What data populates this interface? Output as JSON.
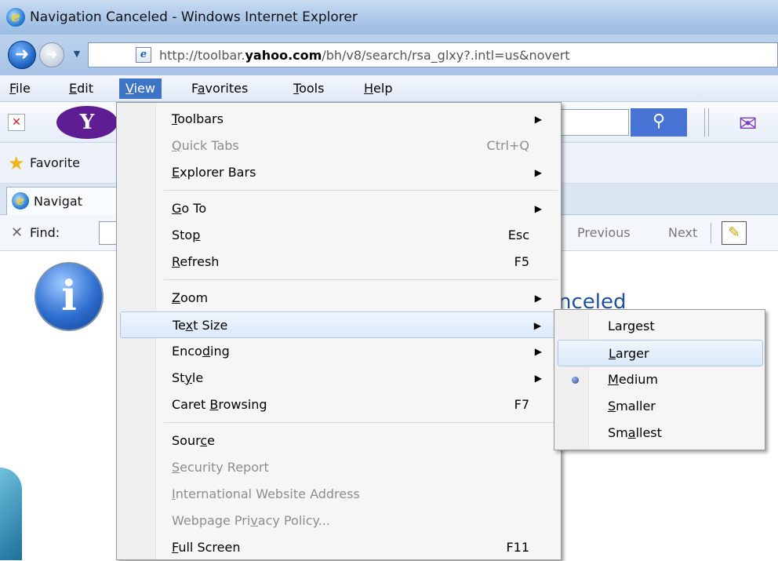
{
  "window": {
    "title": "Navigation Canceled - Windows Internet Explorer"
  },
  "address_bar": {
    "url_prefix": "http://toolbar.",
    "url_bold": "yahoo.com",
    "url_suffix": "/bh/v8/search/rsa_glxy?.intl=us&novert"
  },
  "menubar": {
    "items": [
      "File",
      "Edit",
      "View",
      "Favorites",
      "Tools",
      "Help"
    ],
    "active": "View"
  },
  "yahoo_toolbar": {
    "logo": "Y"
  },
  "favorites_bar": {
    "label": "Favorite"
  },
  "tabs": [
    {
      "label": "Navigat"
    }
  ],
  "find_bar": {
    "label": "Find:",
    "previous": "Previous",
    "next": "Next"
  },
  "page": {
    "heading": "nceled"
  },
  "view_menu": {
    "items": [
      {
        "label": "Toolbars",
        "shortcut": "",
        "submenu": true,
        "disabled": false
      },
      {
        "label": "Quick Tabs",
        "shortcut": "Ctrl+Q",
        "submenu": false,
        "disabled": true
      },
      {
        "label": "Explorer Bars",
        "shortcut": "",
        "submenu": true,
        "disabled": false
      },
      {
        "label": "Go To",
        "shortcut": "",
        "submenu": true,
        "disabled": false
      },
      {
        "label": "Stop",
        "shortcut": "Esc",
        "submenu": false,
        "disabled": false
      },
      {
        "label": "Refresh",
        "shortcut": "F5",
        "submenu": false,
        "disabled": false
      },
      {
        "label": "Zoom",
        "shortcut": "",
        "submenu": true,
        "disabled": false
      },
      {
        "label": "Text Size",
        "shortcut": "",
        "submenu": true,
        "disabled": false,
        "highlighted": true
      },
      {
        "label": "Encoding",
        "shortcut": "",
        "submenu": true,
        "disabled": false
      },
      {
        "label": "Style",
        "shortcut": "",
        "submenu": true,
        "disabled": false
      },
      {
        "label": "Caret Browsing",
        "shortcut": "F7",
        "submenu": false,
        "disabled": false
      },
      {
        "label": "Source",
        "shortcut": "",
        "submenu": false,
        "disabled": false
      },
      {
        "label": "Security Report",
        "shortcut": "",
        "submenu": false,
        "disabled": true
      },
      {
        "label": "International Website Address",
        "shortcut": "",
        "submenu": false,
        "disabled": true
      },
      {
        "label": "Webpage Privacy Policy...",
        "shortcut": "",
        "submenu": false,
        "disabled": true
      },
      {
        "label": "Full Screen",
        "shortcut": "F11",
        "submenu": false,
        "disabled": false
      }
    ]
  },
  "text_size_menu": {
    "items": [
      {
        "label": "Largest",
        "selected": false,
        "highlighted": false
      },
      {
        "label": "Larger",
        "selected": false,
        "highlighted": true
      },
      {
        "label": "Medium",
        "selected": true,
        "highlighted": false
      },
      {
        "label": "Smaller",
        "selected": false,
        "highlighted": false
      },
      {
        "label": "Smallest",
        "selected": false,
        "highlighted": false
      }
    ]
  },
  "colors": {
    "menu_active": "#3d75c4",
    "highlight_border": "#a9c6ea",
    "yahoo_purple": "#5e1d93"
  }
}
